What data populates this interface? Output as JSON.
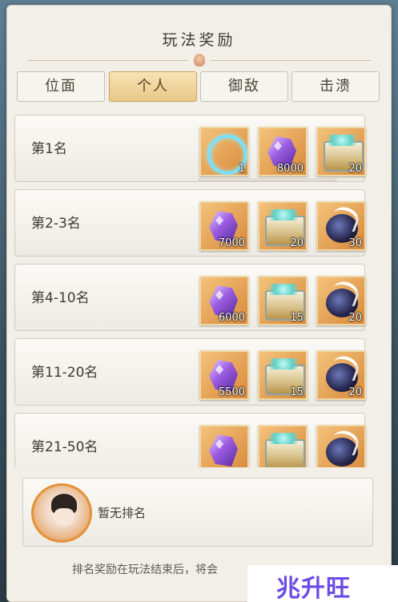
{
  "title": "玩法奖励",
  "tabs": [
    "位面",
    "个人",
    "御敌",
    "击溃"
  ],
  "active_tab": "个人",
  "ranks": [
    {
      "label": "第1名",
      "rewards": [
        {
          "icon": "ring-icon",
          "qty": "1"
        },
        {
          "icon": "gem-icon",
          "qty": "8000"
        },
        {
          "icon": "chest-icon",
          "qty": "20"
        }
      ]
    },
    {
      "label": "第2-3名",
      "rewards": [
        {
          "icon": "gem-icon",
          "qty": "7000"
        },
        {
          "icon": "chest-icon",
          "qty": "20"
        },
        {
          "icon": "orb-icon",
          "qty": "30"
        }
      ]
    },
    {
      "label": "第4-10名",
      "rewards": [
        {
          "icon": "gem-icon",
          "qty": "6000"
        },
        {
          "icon": "chest-icon",
          "qty": "15"
        },
        {
          "icon": "orb-icon",
          "qty": "20"
        }
      ]
    },
    {
      "label": "第11-20名",
      "rewards": [
        {
          "icon": "gem-icon",
          "qty": "5500"
        },
        {
          "icon": "chest-icon",
          "qty": "15"
        },
        {
          "icon": "orb-icon",
          "qty": "20"
        }
      ]
    },
    {
      "label": "第21-50名",
      "rewards": [
        {
          "icon": "gem-icon",
          "qty": ""
        },
        {
          "icon": "chest-icon",
          "qty": ""
        },
        {
          "icon": "orb-icon",
          "qty": ""
        }
      ]
    }
  ],
  "self": {
    "status": "暂无排名"
  },
  "footer": "排名奖励在玩法结束后，将会",
  "brand": "兆升旺",
  "colors": {
    "accent": "#e8c887",
    "panel": "#f1efe8",
    "brand": "#6a4ce6"
  }
}
